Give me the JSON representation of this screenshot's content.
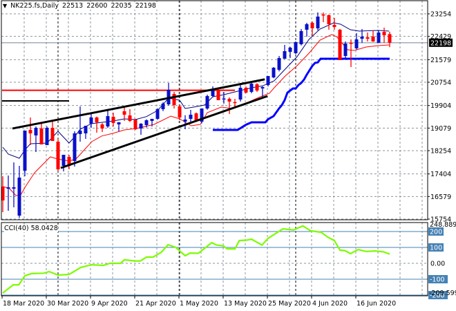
{
  "header": {
    "symbol": "NK225.fs,Daily",
    "open": "22513",
    "high": "22600",
    "low": "22035",
    "close": "22198",
    "menu_icon": "triangle-down-icon"
  },
  "colors": {
    "bull": "#0a10c8",
    "bear": "#ff0000",
    "ma_fast": "#000080",
    "ma_slow": "#ff0000",
    "thick_line": "#0000ff",
    "trendline": "#000000",
    "resistance": "#ff0000",
    "cci": "#7cfc00",
    "cci_levels": "#4682b4",
    "grid": "#8a939c",
    "separator": "#000000"
  },
  "chart_data": [
    {
      "type": "candlestick",
      "title": "NK225.fs,Daily",
      "ylim": [
        15754,
        23254
      ],
      "yticks": [
        "23254",
        "22429",
        "21579",
        "20754",
        "19904",
        "19079",
        "18254",
        "17404",
        "16579",
        "15754"
      ],
      "ytick_values": [
        23254,
        22429,
        21579,
        20754,
        19904,
        19079,
        18254,
        17404,
        16579,
        15754
      ],
      "current_price_label": "22198",
      "current_price": 22198,
      "xticks": [
        {
          "index": 0,
          "label": "18 Mar 2020"
        },
        {
          "index": 8,
          "label": "30 Mar 2020"
        },
        {
          "index": 16,
          "label": "9 Apr 2020"
        },
        {
          "index": 24,
          "label": "21 Apr 2020"
        },
        {
          "index": 32,
          "label": "1 May 2020"
        },
        {
          "index": 40,
          "label": "13 May 2020"
        },
        {
          "index": 48,
          "label": "25 May 2020"
        },
        {
          "index": 56,
          "label": "4 Jun 2020"
        },
        {
          "index": 64,
          "label": "16 Jun 2020"
        }
      ],
      "month_separators": [
        10,
        32,
        53
      ],
      "ohlc": [
        [
          16942,
          17320,
          16007,
          16434
        ],
        [
          16866,
          17346,
          16058,
          16916
        ],
        [
          16866,
          17825,
          16184,
          16916
        ],
        [
          15881,
          17699,
          15800,
          17270
        ],
        [
          17522,
          18987,
          17320,
          18987
        ],
        [
          19012,
          19467,
          18457,
          18886
        ],
        [
          18810,
          19138,
          18204,
          19088
        ],
        [
          19063,
          19265,
          18482,
          18482
        ],
        [
          18457,
          19138,
          18457,
          19088
        ],
        [
          19088,
          19340,
          18608,
          18608
        ],
        [
          18583,
          18700,
          17497,
          17573
        ],
        [
          17699,
          18103,
          17497,
          18103
        ],
        [
          18027,
          18100,
          17573,
          17699
        ],
        [
          17876,
          18962,
          17674,
          18886
        ],
        [
          18861,
          19870,
          18583,
          18987
        ],
        [
          18886,
          19164,
          18684,
          19164
        ],
        [
          19239,
          19618,
          19088,
          19467
        ],
        [
          19467,
          19500,
          18911,
          19290
        ],
        [
          19214,
          19260,
          18936,
          19063
        ],
        [
          19138,
          19769,
          19088,
          19517
        ],
        [
          19492,
          19643,
          19138,
          19265
        ],
        [
          19214,
          19300,
          18962,
          19290
        ],
        [
          19694,
          19870,
          19340,
          19568
        ],
        [
          19542,
          19769,
          19300,
          19340
        ],
        [
          19391,
          19420,
          19012,
          19037
        ],
        [
          19063,
          19260,
          18835,
          19239
        ],
        [
          19189,
          19400,
          19100,
          19366
        ],
        [
          19340,
          19420,
          19138,
          19416
        ],
        [
          19416,
          19800,
          19380,
          19769
        ],
        [
          19769,
          20022,
          19700,
          19972
        ],
        [
          19946,
          20729,
          19900,
          20477
        ],
        [
          20325,
          20400,
          19795,
          19921
        ],
        [
          19870,
          19920,
          19366,
          19467
        ],
        [
          19315,
          19550,
          19037,
          19391
        ],
        [
          19416,
          19744,
          19300,
          19568
        ],
        [
          19618,
          19650,
          19300,
          19340
        ],
        [
          19315,
          19800,
          19250,
          19795
        ],
        [
          19795,
          20300,
          19750,
          20249
        ],
        [
          20249,
          20603,
          20200,
          20502
        ],
        [
          20451,
          20500,
          20098,
          20098
        ],
        [
          20148,
          20401,
          19972,
          20160
        ],
        [
          20148,
          20200,
          19593,
          20047
        ],
        [
          20030,
          20148,
          19820,
          20010
        ],
        [
          20123,
          20729,
          20050,
          20552
        ],
        [
          20552,
          20600,
          20350,
          20376
        ],
        [
          20401,
          20750,
          20350,
          20704
        ],
        [
          20679,
          20720,
          20400,
          20451
        ],
        [
          20527,
          20600,
          20174,
          20578
        ],
        [
          20653,
          20982,
          20600,
          20982
        ],
        [
          20931,
          21310,
          20900,
          21284
        ],
        [
          21209,
          21714,
          21150,
          21638
        ],
        [
          21613,
          22118,
          21600,
          21890
        ],
        [
          21865,
          22050,
          21638,
          22017
        ],
        [
          21815,
          22250,
          21780,
          22219
        ],
        [
          22143,
          22699,
          22100,
          22623
        ],
        [
          22673,
          22926,
          22421,
          22875
        ],
        [
          22926,
          22976,
          22446,
          22724
        ],
        [
          22724,
          23304,
          22650,
          23153
        ],
        [
          23229,
          23304,
          22950,
          23204
        ],
        [
          23204,
          23230,
          22673,
          22875
        ],
        [
          22850,
          23103,
          22673,
          22774
        ],
        [
          22673,
          22700,
          21562,
          21562
        ],
        [
          21714,
          22244,
          21650,
          22168
        ],
        [
          22194,
          22320,
          21310,
          22168
        ],
        [
          21992,
          22547,
          21950,
          22320
        ],
        [
          22345,
          22699,
          22194,
          22421
        ],
        [
          22396,
          22572,
          22244,
          22345
        ],
        [
          22421,
          22648,
          22230,
          22244
        ],
        [
          22194,
          22648,
          22194,
          22572
        ],
        [
          22598,
          22749,
          22194,
          22471
        ],
        [
          22513,
          22600,
          22035,
          22198
        ]
      ],
      "ma_fast": [
        [
          0,
          18381
        ],
        [
          1,
          18128
        ],
        [
          3,
          17977
        ],
        [
          4,
          18280
        ],
        [
          5,
          18507
        ],
        [
          8,
          18532
        ],
        [
          10,
          18960
        ],
        [
          12,
          18532
        ],
        [
          13,
          18760
        ],
        [
          14,
          19037
        ],
        [
          16,
          19239
        ],
        [
          18,
          19290
        ],
        [
          20,
          19340
        ],
        [
          22,
          19416
        ],
        [
          24,
          19390
        ],
        [
          26,
          19500
        ],
        [
          28,
          19720
        ],
        [
          30,
          20174
        ],
        [
          32,
          20098
        ],
        [
          33,
          19795
        ],
        [
          34.5,
          19845
        ],
        [
          36.5,
          19920
        ],
        [
          38,
          20224
        ],
        [
          40,
          20300
        ],
        [
          42,
          20400
        ],
        [
          45,
          20552
        ],
        [
          47,
          20620
        ],
        [
          49.1,
          20805
        ],
        [
          51.1,
          21234
        ],
        [
          53.25,
          21689
        ],
        [
          55.4,
          22320
        ],
        [
          57.4,
          22699
        ],
        [
          59.9,
          22926
        ],
        [
          61.1,
          22875
        ],
        [
          62.9,
          22673
        ],
        [
          64.5,
          22623
        ],
        [
          67.9,
          22648
        ],
        [
          69.9,
          22623
        ]
      ],
      "ma_slow": [
        [
          0,
          16942
        ],
        [
          1.1,
          16891
        ],
        [
          2.4,
          16613
        ],
        [
          3.25,
          16638
        ],
        [
          4.1,
          16942
        ],
        [
          5.75,
          17446
        ],
        [
          8.6,
          18027
        ],
        [
          9.9,
          17952
        ],
        [
          12,
          17876
        ],
        [
          13.25,
          17952
        ],
        [
          16.1,
          18583
        ],
        [
          17.9,
          18790
        ],
        [
          19.9,
          18886
        ],
        [
          22,
          19012
        ],
        [
          24.1,
          19063
        ],
        [
          27.4,
          19214
        ],
        [
          30.4,
          19517
        ],
        [
          32,
          19416
        ],
        [
          34.1,
          19164
        ],
        [
          35.75,
          19214
        ],
        [
          37,
          19643
        ],
        [
          39.5,
          19845
        ],
        [
          41.6,
          19795
        ],
        [
          43.25,
          19921
        ],
        [
          46.6,
          20224
        ],
        [
          48.25,
          20350
        ],
        [
          49.1,
          20552
        ],
        [
          51.1,
          20982
        ],
        [
          53.25,
          21360
        ],
        [
          55.4,
          21815
        ],
        [
          57.4,
          22295
        ],
        [
          59.5,
          22496
        ],
        [
          60.4,
          22421
        ],
        [
          62.4,
          21941
        ],
        [
          63.6,
          21916
        ],
        [
          65.75,
          22042
        ],
        [
          67.9,
          22093
        ],
        [
          69.9,
          22118
        ]
      ],
      "thick_line": [
        [
          38,
          19012
        ],
        [
          42.5,
          19012
        ],
        [
          44,
          19200
        ],
        [
          45,
          19290
        ],
        [
          47.5,
          19290
        ],
        [
          48,
          19400
        ],
        [
          49,
          19517
        ],
        [
          50,
          19800
        ],
        [
          50.5,
          19921
        ],
        [
          51,
          20100
        ],
        [
          51.5,
          20376
        ],
        [
          52,
          20450
        ],
        [
          52.5,
          20527
        ],
        [
          53,
          20527
        ],
        [
          53.5,
          20650
        ],
        [
          54,
          20729
        ],
        [
          54.5,
          20850
        ],
        [
          55,
          21032
        ],
        [
          56,
          21350
        ],
        [
          56.5,
          21461
        ],
        [
          57,
          21480
        ],
        [
          57.5,
          21613
        ],
        [
          70,
          21613
        ]
      ],
      "trendlines": [
        {
          "name": "upper-channel",
          "from": [
            1.75,
            19063
          ],
          "to": [
            47.4,
            20860
          ]
        },
        {
          "name": "lower-channel",
          "from": [
            10.5,
            17623
          ],
          "to": [
            47.9,
            20249
          ]
        }
      ],
      "horizontal_lines": [
        {
          "name": "resistance-red",
          "price": 20460,
          "from": 0,
          "to": 42
        },
        {
          "name": "level-black",
          "price": 20072,
          "from": 0,
          "to": 12
        }
      ]
    },
    {
      "type": "line",
      "title": "CCI(40)",
      "label": "CCI(40)",
      "last_value": "58.0428",
      "ylim": [
        -209.599,
        248.8891
      ],
      "ymax_label": "248.8891",
      "ymin_label": "-209.599",
      "levels": [
        {
          "value": 200,
          "label": "200"
        },
        {
          "value": 100,
          "label": "100"
        },
        {
          "value": -100,
          "label": "-100"
        },
        {
          "value": -200,
          "label": "-200"
        }
      ],
      "zero_label": "0.00",
      "points": [
        [
          0,
          -187
        ],
        [
          1.9,
          -135
        ],
        [
          2.9,
          -135
        ],
        [
          4,
          -78
        ],
        [
          5.2,
          -65
        ],
        [
          7.4,
          -62
        ],
        [
          8.4,
          -52
        ],
        [
          10,
          -74
        ],
        [
          12,
          -70
        ],
        [
          14.1,
          -26
        ],
        [
          16,
          -9
        ],
        [
          18.2,
          -13
        ],
        [
          19.4,
          0
        ],
        [
          21.3,
          0
        ],
        [
          22,
          22
        ],
        [
          23.9,
          15
        ],
        [
          24.9,
          15
        ],
        [
          26,
          39
        ],
        [
          27.2,
          39
        ],
        [
          28.7,
          70
        ],
        [
          29.9,
          117
        ],
        [
          31.3,
          100
        ],
        [
          33,
          48
        ],
        [
          33.9,
          65
        ],
        [
          35.4,
          63
        ],
        [
          37.8,
          130
        ],
        [
          38.7,
          115
        ],
        [
          39.9,
          110
        ],
        [
          40.6,
          91
        ],
        [
          42,
          91
        ],
        [
          42.8,
          143
        ],
        [
          44.2,
          146
        ],
        [
          45,
          152
        ],
        [
          46.9,
          115
        ],
        [
          48,
          157
        ],
        [
          50.7,
          217
        ],
        [
          52.6,
          210
        ],
        [
          54.3,
          235
        ],
        [
          55.7,
          205
        ],
        [
          57.6,
          195
        ],
        [
          58.8,
          165
        ],
        [
          60,
          143
        ],
        [
          61,
          83
        ],
        [
          61.9,
          80
        ],
        [
          62.9,
          61
        ],
        [
          64.3,
          87
        ],
        [
          65.7,
          75
        ],
        [
          67.4,
          78
        ],
        [
          68.9,
          72
        ],
        [
          70,
          58.04
        ]
      ]
    }
  ]
}
